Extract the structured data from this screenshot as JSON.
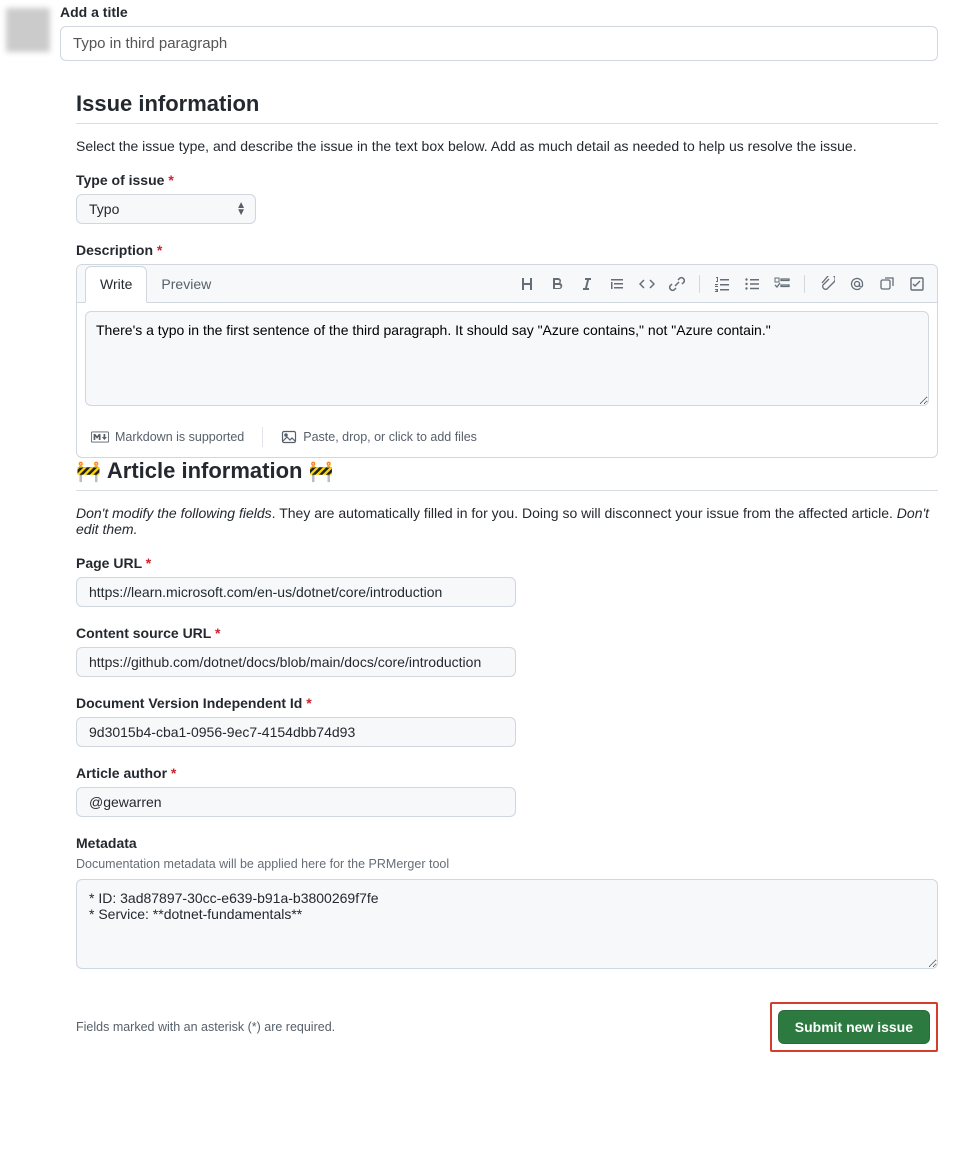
{
  "title_label": "Add a title",
  "title_value": "Typo in third paragraph",
  "issue_info": {
    "heading": "Issue information",
    "description": "Select the issue type, and describe the issue in the text box below. Add as much detail as needed to help us resolve the issue."
  },
  "type_of_issue": {
    "label": "Type of issue",
    "selected": "Typo"
  },
  "description_field": {
    "label": "Description",
    "tabs": {
      "write": "Write",
      "preview": "Preview"
    },
    "value": "There's a typo in the first sentence of the third paragraph. It should say \"Azure contains,\" not \"Azure contain.\"",
    "footer_markdown": "Markdown is supported",
    "footer_attach": "Paste, drop, or click to add files"
  },
  "article_info": {
    "heading": "Article information",
    "note_prefix": "Don't modify the following fields",
    "note_rest": ". They are automatically filled in for you. Doing so will disconnect your issue from the affected article. ",
    "note_suffix": "Don't edit them."
  },
  "page_url": {
    "label": "Page URL",
    "value": "https://learn.microsoft.com/en-us/dotnet/core/introduction"
  },
  "content_source_url": {
    "label": "Content source URL",
    "value": "https://github.com/dotnet/docs/blob/main/docs/core/introduction"
  },
  "doc_version_id": {
    "label": "Document Version Independent Id",
    "value": "9d3015b4-cba1-0956-9ec7-4154dbb74d93"
  },
  "article_author": {
    "label": "Article author",
    "value": "@gewarren"
  },
  "metadata": {
    "label": "Metadata",
    "help": "Documentation metadata will be applied here for the PRMerger tool",
    "value": "* ID: 3ad87897-30cc-e639-b91a-b3800269f7fe\n* Service: **dotnet-fundamentals**"
  },
  "footnote": "Fields marked with an asterisk (*) are required.",
  "submit_label": "Submit new issue",
  "icons": {
    "heading": "heading-icon",
    "bold": "bold-icon",
    "italic": "italic-icon",
    "quote": "quote-icon",
    "code": "code-icon",
    "link": "link-icon",
    "ordered": "ordered-list-icon",
    "unordered": "unordered-list-icon",
    "tasklist": "task-list-icon",
    "attach": "attach-icon",
    "mention": "mention-icon",
    "crossref": "cross-reference-icon",
    "saved": "saved-reply-icon"
  }
}
